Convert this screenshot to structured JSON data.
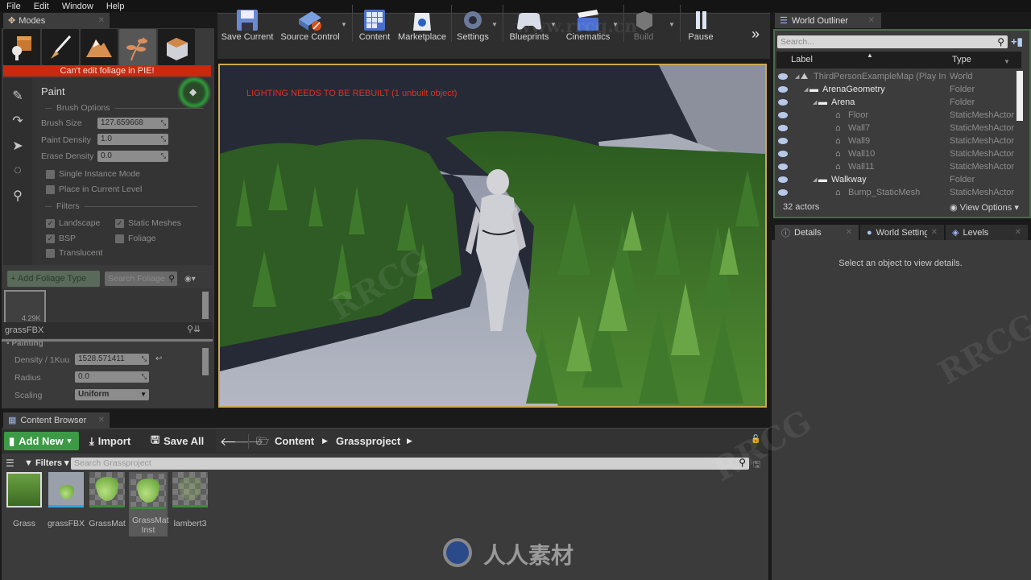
{
  "menu": [
    "File",
    "Edit",
    "Window",
    "Help"
  ],
  "modes": {
    "tab_label": "Modes",
    "mode_buttons": [
      "place-mode",
      "paint-mode",
      "landscape-mode",
      "foliage-mode",
      "geometry-mode"
    ],
    "warning": "Can't edit foliage in PIE!",
    "tool_title": "Paint",
    "brush_options_header": "Brush Options",
    "brush_size_label": "Brush Size",
    "brush_size_value": "127.659668",
    "paint_density_label": "Paint Density",
    "paint_density_value": "1.0",
    "erase_density_label": "Erase Density",
    "erase_density_value": "0.0",
    "single_instance_label": "Single Instance Mode",
    "single_instance_checked": false,
    "place_in_level_label": "Place in Current Level",
    "place_in_level_checked": false,
    "filters_header": "Filters",
    "filters": [
      {
        "label": "Landscape",
        "checked": true
      },
      {
        "label": "Static Meshes",
        "checked": true
      },
      {
        "label": "BSP",
        "checked": true
      },
      {
        "label": "Foliage",
        "checked": false
      },
      {
        "label": "Translucent",
        "checked": false
      }
    ],
    "add_foliage_label": "+ Add Foliage Type",
    "search_foliage_placeholder": "Search Foliage",
    "foliage_item_count": "4.29K",
    "foliage_item_name": "grassFBX",
    "painting_header": "Painting",
    "density_label": "Density / 1Kuu",
    "density_value": "1528.571411",
    "radius_label": "Radius",
    "radius_value": "0.0",
    "scaling_label": "Scaling",
    "scaling_value": "Uniform"
  },
  "toolbar": {
    "buttons": [
      {
        "label": "Save Current"
      },
      {
        "label": "Source Control"
      },
      {
        "label": "Content"
      },
      {
        "label": "Marketplace"
      },
      {
        "label": "Settings"
      },
      {
        "label": "Blueprints"
      },
      {
        "label": "Cinematics"
      },
      {
        "label": "Build"
      },
      {
        "label": "Pause"
      }
    ],
    "overflow": "»"
  },
  "viewport": {
    "warning": "LIGHTING NEEDS TO BE REBUILT (1 unbuilt object)"
  },
  "outliner": {
    "tab_label": "World Outliner",
    "search_placeholder": "Search...",
    "col_label": "Label",
    "col_type": "Type",
    "rows": [
      {
        "label": "ThirdPersonExampleMap (Play In",
        "type": "World",
        "depth": 0,
        "kind": "world"
      },
      {
        "label": "ArenaGeometry",
        "type": "Folder",
        "depth": 1,
        "kind": "folder"
      },
      {
        "label": "Arena",
        "type": "Folder",
        "depth": 2,
        "kind": "folder"
      },
      {
        "label": "Floor",
        "type": "StaticMeshActor",
        "depth": 3,
        "kind": "mesh"
      },
      {
        "label": "Wall7",
        "type": "StaticMeshActor",
        "depth": 3,
        "kind": "mesh"
      },
      {
        "label": "Wall9",
        "type": "StaticMeshActor",
        "depth": 3,
        "kind": "mesh"
      },
      {
        "label": "Wall10",
        "type": "StaticMeshActor",
        "depth": 3,
        "kind": "mesh"
      },
      {
        "label": "Wall11",
        "type": "StaticMeshActor",
        "depth": 3,
        "kind": "mesh"
      },
      {
        "label": "Walkway",
        "type": "Folder",
        "depth": 2,
        "kind": "folder"
      },
      {
        "label": "Bump_StaticMesh",
        "type": "StaticMeshActor",
        "depth": 3,
        "kind": "mesh"
      }
    ],
    "actor_count": "32 actors",
    "view_options": "View Options"
  },
  "details": {
    "tabs": [
      {
        "label": "Details",
        "active": true
      },
      {
        "label": "World Setting",
        "active": false
      },
      {
        "label": "Levels",
        "active": false
      }
    ],
    "empty_message": "Select an object to view details."
  },
  "content_browser": {
    "tab_label": "Content Browser",
    "add_new": "Add New",
    "import": "Import",
    "save_all": "Save All",
    "path": [
      "Content",
      "Grassproject"
    ],
    "filters_label": "Filters",
    "search_placeholder": "Search Grassproject",
    "assets": [
      {
        "name": "Grass",
        "kind": "texture",
        "bar_color": "#c8502a"
      },
      {
        "name": "grassFBX",
        "kind": "static-mesh",
        "bar_color": "#2aa8e0"
      },
      {
        "name": "GrassMat",
        "kind": "material",
        "bar_color": "#3a8a3a"
      },
      {
        "name": "GrassMat Inst",
        "kind": "material-instance",
        "bar_color": "#3a8a3a",
        "selected": true
      },
      {
        "name": "lambert3",
        "kind": "material",
        "bar_color": "#3a8a3a"
      }
    ]
  },
  "watermark": {
    "text": "人人素材",
    "site": "www.rrcg.cn",
    "brand": "RRCG"
  },
  "colors": {
    "accent_green": "#3c9a46",
    "warning_red": "#c8290f",
    "viewport_border": "#c9a856"
  }
}
